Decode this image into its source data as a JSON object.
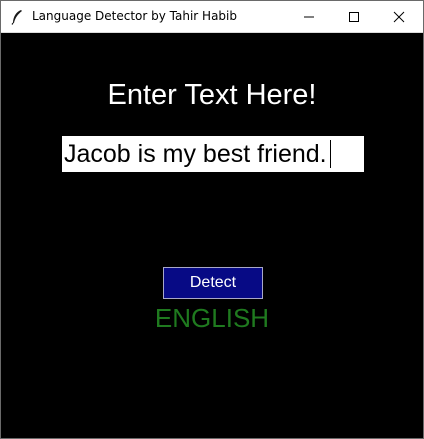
{
  "window": {
    "title": "Language Detector by Tahir Habib",
    "icon": "feather-icon",
    "controls": [
      "minimize-icon",
      "maximize-icon",
      "close-icon"
    ]
  },
  "main": {
    "heading": "Enter Text Here!",
    "input_value": "Jacob is my best friend.",
    "detect_label": "Detect",
    "result": "ENGLISH"
  },
  "colors": {
    "background": "#000000",
    "heading": "#ffffff",
    "button_bg": "#070a85",
    "result": "#1f7a1f"
  }
}
